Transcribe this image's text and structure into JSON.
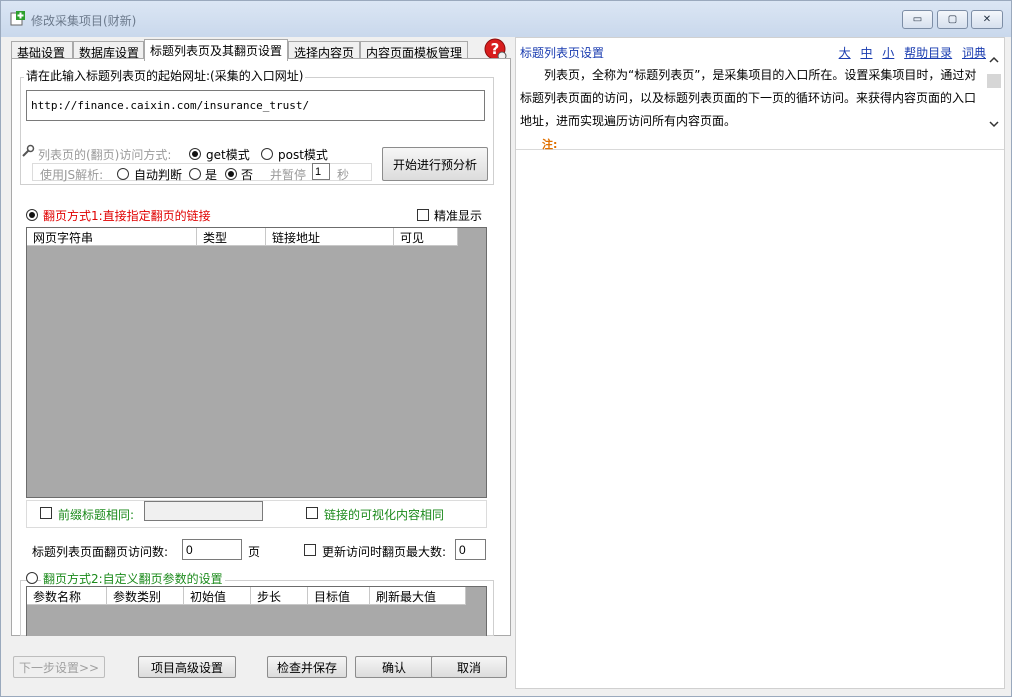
{
  "window": {
    "title": "修改采集项目(财新)",
    "controls": {
      "minimize": "▭",
      "maximize": "▢",
      "close": "✕"
    }
  },
  "tabs": [
    {
      "label": "基础设置",
      "active": false
    },
    {
      "label": "数据库设置",
      "active": false
    },
    {
      "label": "标题列表页及其翻页设置",
      "active": true
    },
    {
      "label": "选择内容页",
      "active": false
    },
    {
      "label": "内容页面模板管理",
      "active": false
    }
  ],
  "start_url": {
    "group_label": "请在此输入标题列表页的起始网址:(采集的入口网址)",
    "value": "http://finance.caixin.com/insurance_trust/"
  },
  "access": {
    "label": "列表页的(翻页)访问方式:",
    "get_label": "get模式",
    "post_label": "post模式",
    "js_label": "使用JS解析:",
    "auto_label": "自动判断",
    "yes_label": "是",
    "no_label": "否",
    "pause_label": "并暂停",
    "pause_value": "1",
    "seconds_label": "秒",
    "preanalyze_button": "开始进行预分析"
  },
  "mode1": {
    "label": "翻页方式1:直接指定翻页的链接",
    "precise_label": "精准显示",
    "columns": [
      "网页字符串",
      "类型",
      "链接地址",
      "可见"
    ],
    "prefix_label": "前缀标题相同:",
    "prefix_value": "",
    "visual_label": "链接的可视化内容相同",
    "visits_label": "标题列表页面翻页访问数:",
    "visits_value": "0",
    "page_unit": "页",
    "update_max_label": "更新访问时翻页最大数:",
    "update_max_value": "0"
  },
  "mode2": {
    "label": "翻页方式2:自定义翻页参数的设置",
    "columns": [
      "参数名称",
      "参数类别",
      "初始值",
      "步长",
      "目标值",
      "刷新最大值"
    ]
  },
  "footer": {
    "next_button": "下一步设置>>",
    "advanced_button": "项目高级设置",
    "check_save_button": "检查并保存",
    "ok_button": "确认",
    "cancel_button": "取消"
  },
  "help": {
    "title": "标题列表页设置",
    "links": [
      "大",
      "中",
      "小",
      "帮助目录",
      "词典"
    ],
    "body": "列表页，全称为“标题列表页”，是采集项目的入口所在。设置采集项目时，通过对标题列表页面的访问，以及标题列表页面的下一页的循环访问。来获得内容页面的入口地址，进而实现遍历访问所有内容页面。",
    "note": "注:"
  },
  "colors": {
    "accent_link": "#1a3cb0",
    "mode_red": "#e00000",
    "option_green": "#1b8a1b",
    "grid_bg": "#a9a9a9"
  }
}
